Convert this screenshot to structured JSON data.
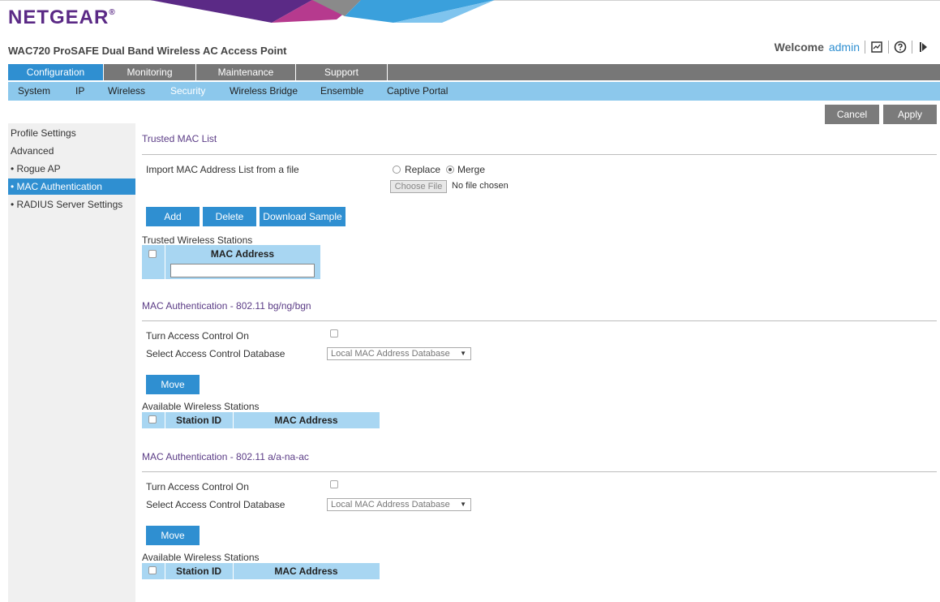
{
  "header": {
    "logo": "NETGEAR",
    "logo_mark": "®",
    "product_title": "WAC720 ProSAFE Dual Band Wireless AC Access Point",
    "welcome_label": "Welcome",
    "username": "admin",
    "icons": [
      "log-icon",
      "help-icon",
      "logout-icon"
    ]
  },
  "nav": {
    "main_tabs": [
      "Configuration",
      "Monitoring",
      "Maintenance",
      "Support"
    ],
    "active_main": "Configuration",
    "sub_tabs": [
      "System",
      "IP",
      "Wireless",
      "Security",
      "Wireless Bridge",
      "Ensemble",
      "Captive Portal"
    ],
    "active_sub": "Security"
  },
  "actions": {
    "cancel": "Cancel",
    "apply": "Apply"
  },
  "sidebar": {
    "items": [
      "Profile Settings",
      "Advanced",
      "• Rogue AP",
      "• MAC Authentication",
      "• RADIUS Server Settings"
    ],
    "active_item": "• MAC Authentication"
  },
  "trusted": {
    "title": "Trusted MAC List",
    "import_label": "Import MAC Address List from a file",
    "radio_replace": "Replace",
    "radio_merge": "Merge",
    "selected_radio": "Merge",
    "choose_file": "Choose File",
    "no_file": "No file chosen",
    "buttons": {
      "add": "Add",
      "delete": "Delete",
      "download": "Download Sample"
    },
    "stations_label": "Trusted Wireless Stations",
    "col_mac": "MAC Address",
    "mac_input_value": ""
  },
  "bgn": {
    "title": "MAC Authentication - 802.11 bg/ng/bgn",
    "access_label": "Turn Access Control On",
    "access_on": false,
    "db_label": "Select Access Control Database",
    "db_value": "Local MAC Address Database",
    "move": "Move",
    "stations_label": "Available Wireless Stations",
    "col_station": "Station ID",
    "col_mac": "MAC Address"
  },
  "ac": {
    "title": "MAC Authentication - 802.11 a/a-na-ac",
    "access_label": "Turn Access Control On",
    "access_on": false,
    "db_label": "Select Access Control Database",
    "db_value": "Local MAC Address Database",
    "move": "Move",
    "stations_label": "Available Wireless Stations",
    "col_station": "Station ID",
    "col_mac": "MAC Address"
  },
  "colors": {
    "brand_purple": "#5b2a86",
    "accent_blue": "#2f8fd1",
    "subnav_blue": "#8cc8ec",
    "nav_gray": "#777777"
  }
}
